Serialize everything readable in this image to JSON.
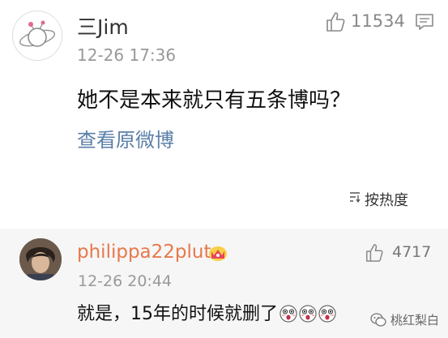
{
  "comment": {
    "username": "三Jim",
    "timestamp": "12-26 17:36",
    "text": "她不是本来就只有五条博吗？",
    "view_original": "查看原微博",
    "like_count": "11534",
    "like_icon": "thumbs-up-icon",
    "comment_icon": "comment-icon"
  },
  "sort": {
    "label": "按热度",
    "icon": "sort-icon"
  },
  "reply": {
    "username": "philippa22pluto",
    "badge_icon": "crown-badge-icon",
    "timestamp": "12-26 20:44",
    "text": "就是，15年的时候就删了",
    "emoji_icon": "shocked-face-emoji",
    "emoji_count": 3,
    "like_count": "4717"
  },
  "watermark": {
    "text": "桃红梨白",
    "icon": "wechat-icon"
  },
  "colors": {
    "reply_background": "#f6f6f6",
    "reply_username": "#e8784a",
    "link": "#5b7fa8",
    "meta": "#999999"
  }
}
